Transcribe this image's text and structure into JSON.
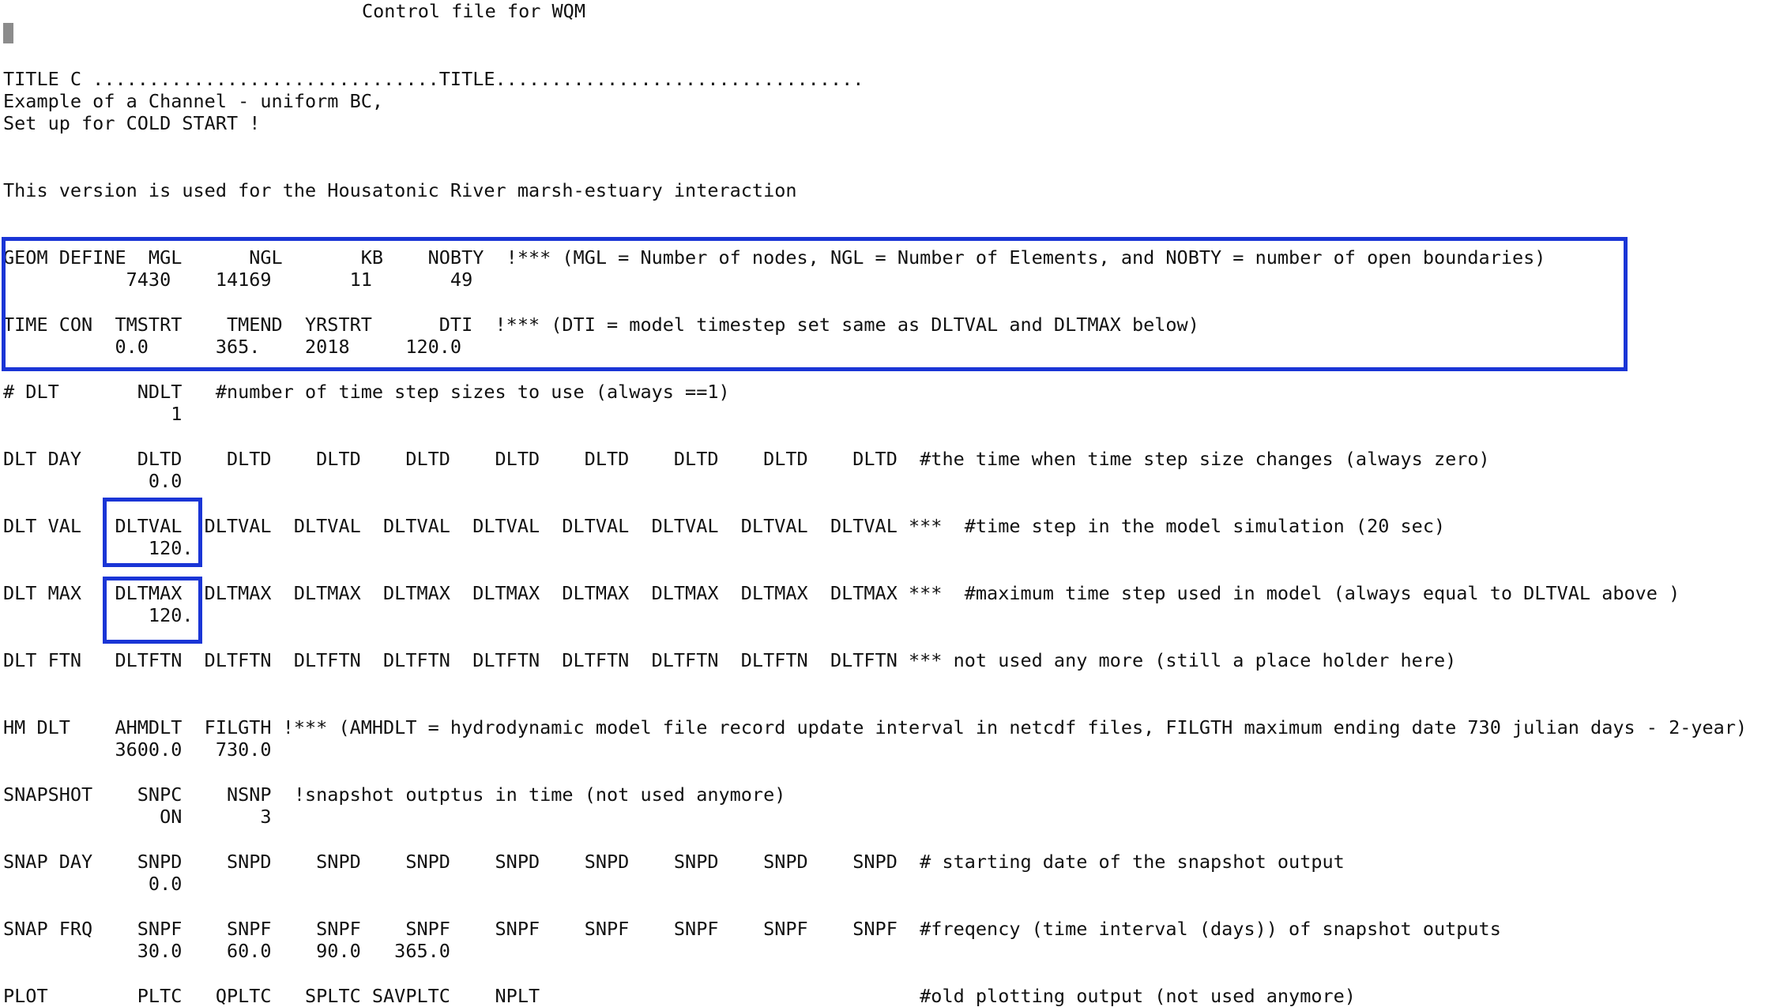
{
  "window": {
    "title": "Control file for WQM"
  },
  "colors": {
    "highlight_border": "#1a35d6",
    "text": "#111111",
    "cursor": "#8c8c8c",
    "background": "#ffffff"
  },
  "lines": [
    "TITLE C ...............................TITLE.................................",
    "Example of a Channel - uniform BC,",
    "Set up for COLD START !",
    "This version is used for the Housatonic River marsh-estuary interaction",
    "GEOM DEFINE  MGL      NGL       KB    NOBTY  !*** (MGL = Number of nodes, NGL = Number of Elements, and NOBTY = number of open boundaries)",
    "           7430    14169       11       49",
    "TIME CON  TMSTRT    TMEND  YRSTRT      DTI  !*** (DTI = model timestep set same as DLTVAL and DLTMAX below)",
    "          0.0      365.    2018     120.0",
    "# DLT       NDLT   #number of time step sizes to use (always ==1)",
    "               1",
    "DLT DAY     DLTD    DLTD    DLTD    DLTD    DLTD    DLTD    DLTD    DLTD    DLTD  #the time when time step size changes (always zero)",
    "             0.0",
    "DLT VAL   DLTVAL  DLTVAL  DLTVAL  DLTVAL  DLTVAL  DLTVAL  DLTVAL  DLTVAL  DLTVAL ***  #time step in the model simulation (20 sec)",
    "             120.",
    "DLT MAX   DLTMAX  DLTMAX  DLTMAX  DLTMAX  DLTMAX  DLTMAX  DLTMAX  DLTMAX  DLTMAX ***  #maximum time step used in model (always equal to DLTVAL above )",
    "             120.",
    "DLT FTN   DLTFTN  DLTFTN  DLTFTN  DLTFTN  DLTFTN  DLTFTN  DLTFTN  DLTFTN  DLTFTN *** not used any more (still a place holder here)",
    "HM DLT    AHMDLT  FILGTH !*** (AMHDLT = hydrodynamic model file record update interval in netcdf files, FILGTH maximum ending date 730 julian days - 2-year)",
    "          3600.0   730.0",
    "SNAPSHOT    SNPC    NSNP  !snapshot outptus in time (not used anymore)",
    "              ON       3",
    "SNAP DAY    SNPD    SNPD    SNPD    SNPD    SNPD    SNPD    SNPD    SNPD    SNPD  # starting date of the snapshot output",
    "             0.0",
    "SNAP FRQ    SNPF    SNPF    SNPF    SNPF    SNPF    SNPF    SNPF    SNPF    SNPF  #freqency (time interval (days)) of snapshot outputs",
    "            30.0    60.0    90.0   365.0",
    "PLOT        PLTC   QPLTC   SPLTC SAVPLTC    NPLT                                  #old plotting output (not used anymore)"
  ]
}
